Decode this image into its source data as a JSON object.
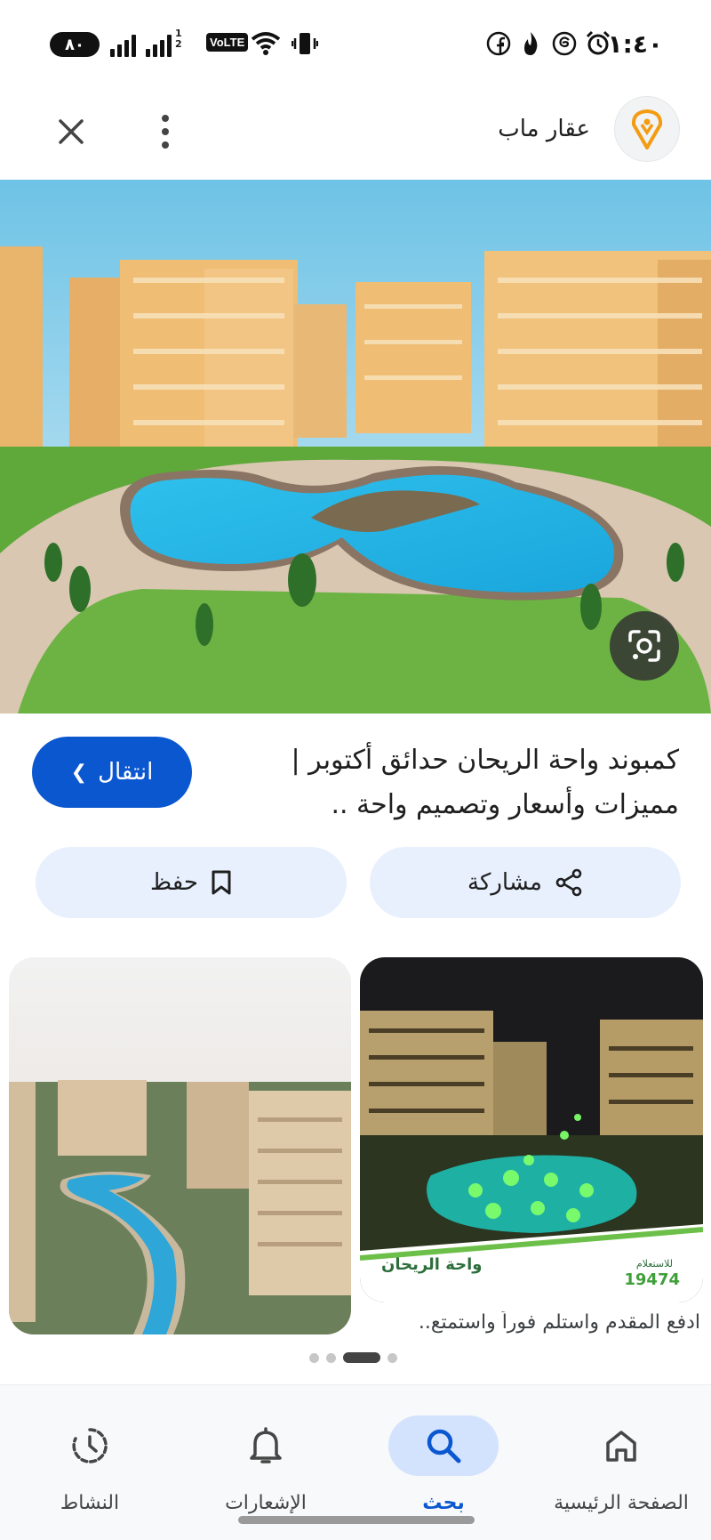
{
  "status_bar": {
    "battery": "٨٠",
    "volte": "VoLTE",
    "sim2_label": "1 2",
    "time": "١:٤٠"
  },
  "header": {
    "site_name": "عقار ماب"
  },
  "result": {
    "title": "كمبوند واحة الريحان حدائق أكتوبر | مميزات وأسعار وتصميم واحة ..",
    "visit_label": "انتقال",
    "save_label": "حفظ",
    "share_label": "مشاركة"
  },
  "related": {
    "right_card_caption": "ادفع المقدم واستلم فوراً واستمتع..",
    "ad_brand": "واحة الريحان",
    "ad_hotline_label": "للاستعلام",
    "ad_hotline": "19474"
  },
  "pager": {
    "count": 4,
    "active_index": 2
  },
  "bottom_nav": {
    "items": [
      {
        "label": "الصفحة الرئيسية",
        "icon": "home-icon"
      },
      {
        "label": "بحث",
        "icon": "search-icon",
        "active": true
      },
      {
        "label": "الإشعارات",
        "icon": "bell-icon"
      },
      {
        "label": "النشاط",
        "icon": "activity-icon"
      }
    ]
  },
  "colors": {
    "accent": "#0b57d0",
    "pill_bg": "#e8f0fe",
    "nav_active_bg": "#d3e3fd"
  }
}
